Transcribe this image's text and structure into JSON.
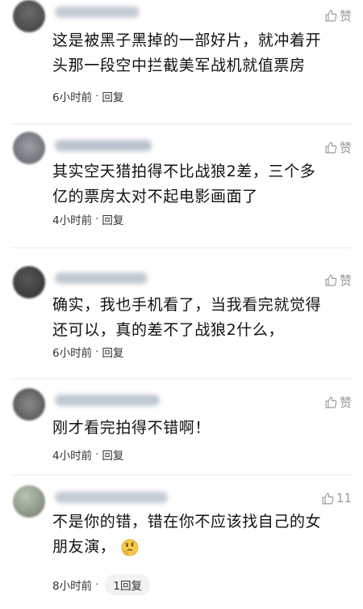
{
  "comments": [
    {
      "text_lines": [
        "这是被黑子黑掉的一部好片，就冲着开",
        "头那一段空中拦截美军战机就值票房"
      ],
      "time": "6小时前",
      "separator": "·",
      "reply": "回复",
      "like": "赞"
    },
    {
      "text_lines": [
        "其实空天猎拍得不比战狼2差，三个多",
        "亿的票房太对不起电影画面了"
      ],
      "time": "4小时前",
      "separator": "·",
      "reply": "回复",
      "like": "赞"
    },
    {
      "text_lines": [
        "确实，我也手机看了，当我看完就觉得",
        "还可以，真的差不了战狼2什么，"
      ],
      "time": "6小时前",
      "separator": "·",
      "reply": "回复",
      "like": "赞"
    },
    {
      "text_lines": [
        "刚才看完拍得不错啊！"
      ],
      "time": "4小时前",
      "separator": "·",
      "reply": "回复",
      "like": "赞"
    },
    {
      "text_lines": [
        "不是你的错，错在你不应该找自己的女",
        "朋友演，"
      ],
      "time": "8小时前",
      "separator": "·",
      "reply": "1回复",
      "like": "11",
      "emoji_icon": "thinking-emoji-icon"
    }
  ],
  "colors": {
    "meta_gray": "#9a9a9a",
    "text": "#111111"
  }
}
